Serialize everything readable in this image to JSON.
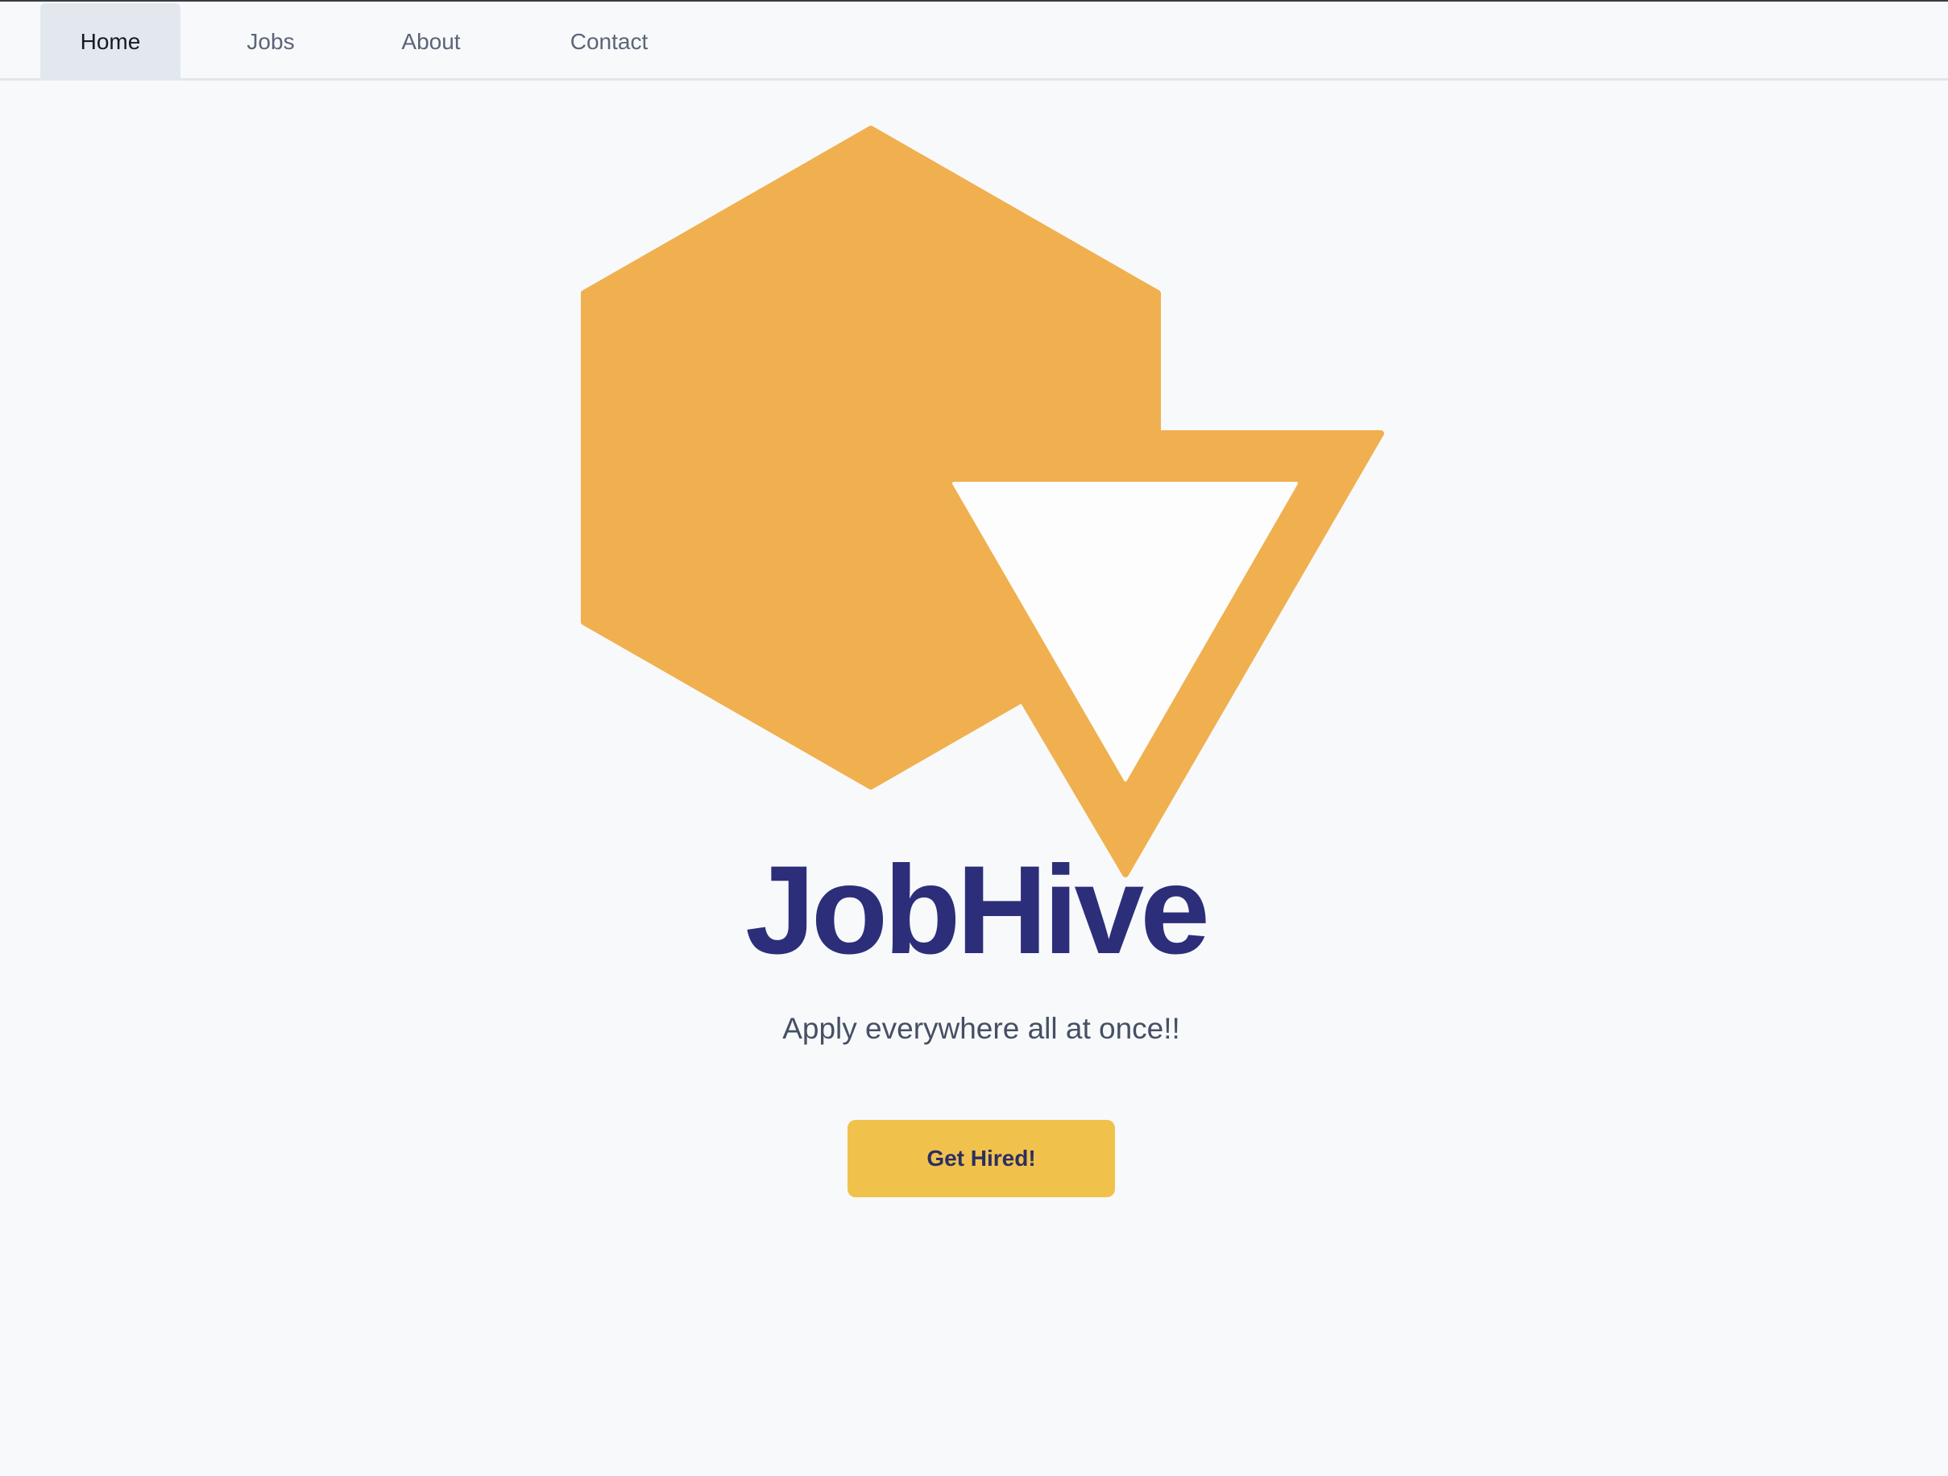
{
  "nav": {
    "items": [
      {
        "label": "Home",
        "active": true
      },
      {
        "label": "Jobs",
        "active": false
      },
      {
        "label": "About",
        "active": false
      },
      {
        "label": "Contact",
        "active": false
      }
    ]
  },
  "hero": {
    "logo_icon": "hexagon-triangle-logo-icon",
    "title": "JobHive",
    "tagline": "Apply everywhere all at once!!",
    "cta_label": "Get Hired!"
  },
  "colors": {
    "accent": "#f0b04f",
    "button": "#f0c24c",
    "title": "#2d2e7a",
    "background": "#f8f9fb"
  }
}
